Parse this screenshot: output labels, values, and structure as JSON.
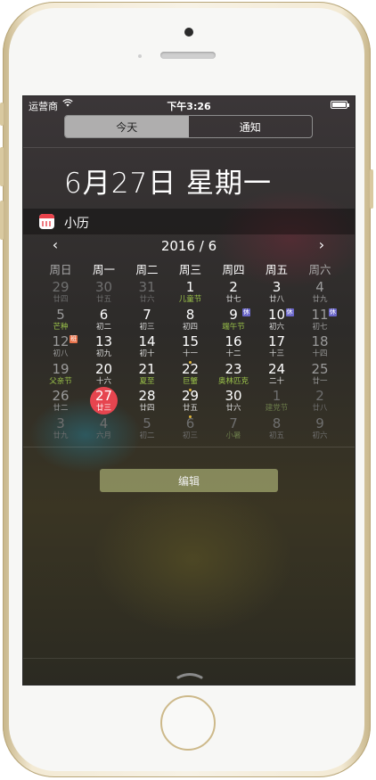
{
  "status_bar": {
    "carrier": "运营商",
    "time": "下午3:26",
    "wifi_icon": "wifi-icon",
    "battery_level": 1.0
  },
  "tabs": [
    {
      "label": "今天",
      "active": true
    },
    {
      "label": "通知",
      "active": false
    }
  ],
  "date_heading": "6月27日 星期一",
  "widget": {
    "title": "小历",
    "icon": "calendar-app-icon"
  },
  "calendar": {
    "prev": "‹",
    "next": "›",
    "month": "2016 / 6",
    "weekdays": [
      "周日",
      "周一",
      "周二",
      "周三",
      "周四",
      "周五",
      "周六"
    ],
    "weeks": [
      [
        {
          "d": "29",
          "s": "廿四",
          "m": "other"
        },
        {
          "d": "30",
          "s": "廿五",
          "m": "other"
        },
        {
          "d": "31",
          "s": "廿六",
          "m": "other"
        },
        {
          "d": "1",
          "s": "儿童节",
          "f": true
        },
        {
          "d": "2",
          "s": "廿七"
        },
        {
          "d": "3",
          "s": "廿八"
        },
        {
          "d": "4",
          "s": "廿九"
        }
      ],
      [
        {
          "d": "5",
          "s": "芒种",
          "f": true
        },
        {
          "d": "6",
          "s": "初二"
        },
        {
          "d": "7",
          "s": "初三"
        },
        {
          "d": "8",
          "s": "初四"
        },
        {
          "d": "9",
          "s": "端午节",
          "f": true,
          "b": "休",
          "bt": "rest"
        },
        {
          "d": "10",
          "s": "初六",
          "b": "休",
          "bt": "rest"
        },
        {
          "d": "11",
          "s": "初七",
          "b": "休",
          "bt": "rest"
        }
      ],
      [
        {
          "d": "12",
          "s": "初八",
          "b": "班",
          "bt": "work"
        },
        {
          "d": "13",
          "s": "初九"
        },
        {
          "d": "14",
          "s": "初十"
        },
        {
          "d": "15",
          "s": "十一",
          "dot": true
        },
        {
          "d": "16",
          "s": "十二"
        },
        {
          "d": "17",
          "s": "十三"
        },
        {
          "d": "18",
          "s": "十四"
        }
      ],
      [
        {
          "d": "19",
          "s": "父亲节",
          "f": true
        },
        {
          "d": "20",
          "s": "十六"
        },
        {
          "d": "21",
          "s": "夏至",
          "f": true
        },
        {
          "d": "22",
          "s": "巨蟹",
          "f": true,
          "dot": true
        },
        {
          "d": "23",
          "s": "奥林匹克",
          "f": true
        },
        {
          "d": "24",
          "s": "二十"
        },
        {
          "d": "25",
          "s": "廿一"
        }
      ],
      [
        {
          "d": "26",
          "s": "廿二"
        },
        {
          "d": "27",
          "s": "廿三",
          "today": true
        },
        {
          "d": "28",
          "s": "廿四"
        },
        {
          "d": "29",
          "s": "廿五",
          "dot": true
        },
        {
          "d": "30",
          "s": "廿六"
        },
        {
          "d": "1",
          "s": "建党节",
          "f": true,
          "m": "other"
        },
        {
          "d": "2",
          "s": "廿八",
          "m": "other"
        }
      ],
      [
        {
          "d": "3",
          "s": "廿九",
          "m": "other"
        },
        {
          "d": "4",
          "s": "六月",
          "m": "other"
        },
        {
          "d": "5",
          "s": "初二",
          "m": "other"
        },
        {
          "d": "6",
          "s": "初三",
          "m": "other"
        },
        {
          "d": "7",
          "s": "小暑",
          "f": true,
          "m": "other"
        },
        {
          "d": "8",
          "s": "初五",
          "m": "other"
        },
        {
          "d": "9",
          "s": "初六",
          "m": "other"
        }
      ]
    ]
  },
  "edit_button": "编辑",
  "colors": {
    "today": "#e6454f",
    "festival": "#9bc34a",
    "rest_badge": "#6b67c9",
    "work_badge": "#e8734b"
  }
}
